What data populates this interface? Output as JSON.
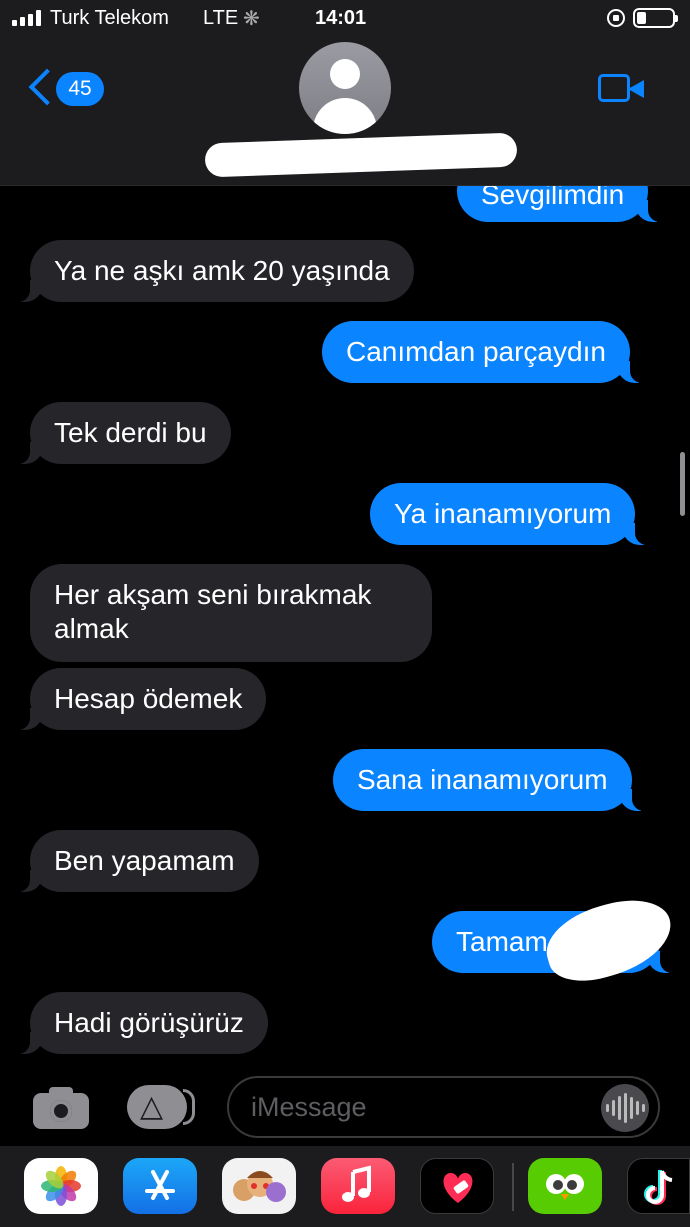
{
  "status_bar": {
    "carrier": "Turk Telekom",
    "network": "LTE",
    "time": "14:01"
  },
  "nav": {
    "back_badge": "45"
  },
  "messages": [
    {
      "from": "me",
      "text": "Sevgilimdin"
    },
    {
      "from": "them",
      "text": "Ya ne aşkı amk 20 yaşında"
    },
    {
      "from": "me",
      "text": "Canımdan parçaydın"
    },
    {
      "from": "them",
      "text": "Tek derdi bu"
    },
    {
      "from": "me",
      "text": "Ya inanamıyorum"
    },
    {
      "from": "them",
      "text": "Her akşam seni bırakmak almak"
    },
    {
      "from": "them",
      "text": "Hesap ödemek"
    },
    {
      "from": "me",
      "text": "Sana inanamıyorum"
    },
    {
      "from": "them",
      "text": "Ben yapamam"
    },
    {
      "from": "me",
      "text": "Tamam"
    },
    {
      "from": "them",
      "text": "Hadi görüşürüz"
    }
  ],
  "composer": {
    "placeholder": "iMessage"
  },
  "app_drawer": [
    {
      "icon": "photos-icon"
    },
    {
      "icon": "app-store-icon"
    },
    {
      "icon": "memoji-icon"
    },
    {
      "icon": "music-icon"
    },
    {
      "icon": "fitness-heart-icon"
    },
    {
      "icon": "duolingo-icon"
    },
    {
      "icon": "tiktok-icon"
    }
  ],
  "colors": {
    "accent": "#0a84ff",
    "incoming_bubble": "#26252a",
    "background": "#000000",
    "header": "#1c1c1e"
  }
}
